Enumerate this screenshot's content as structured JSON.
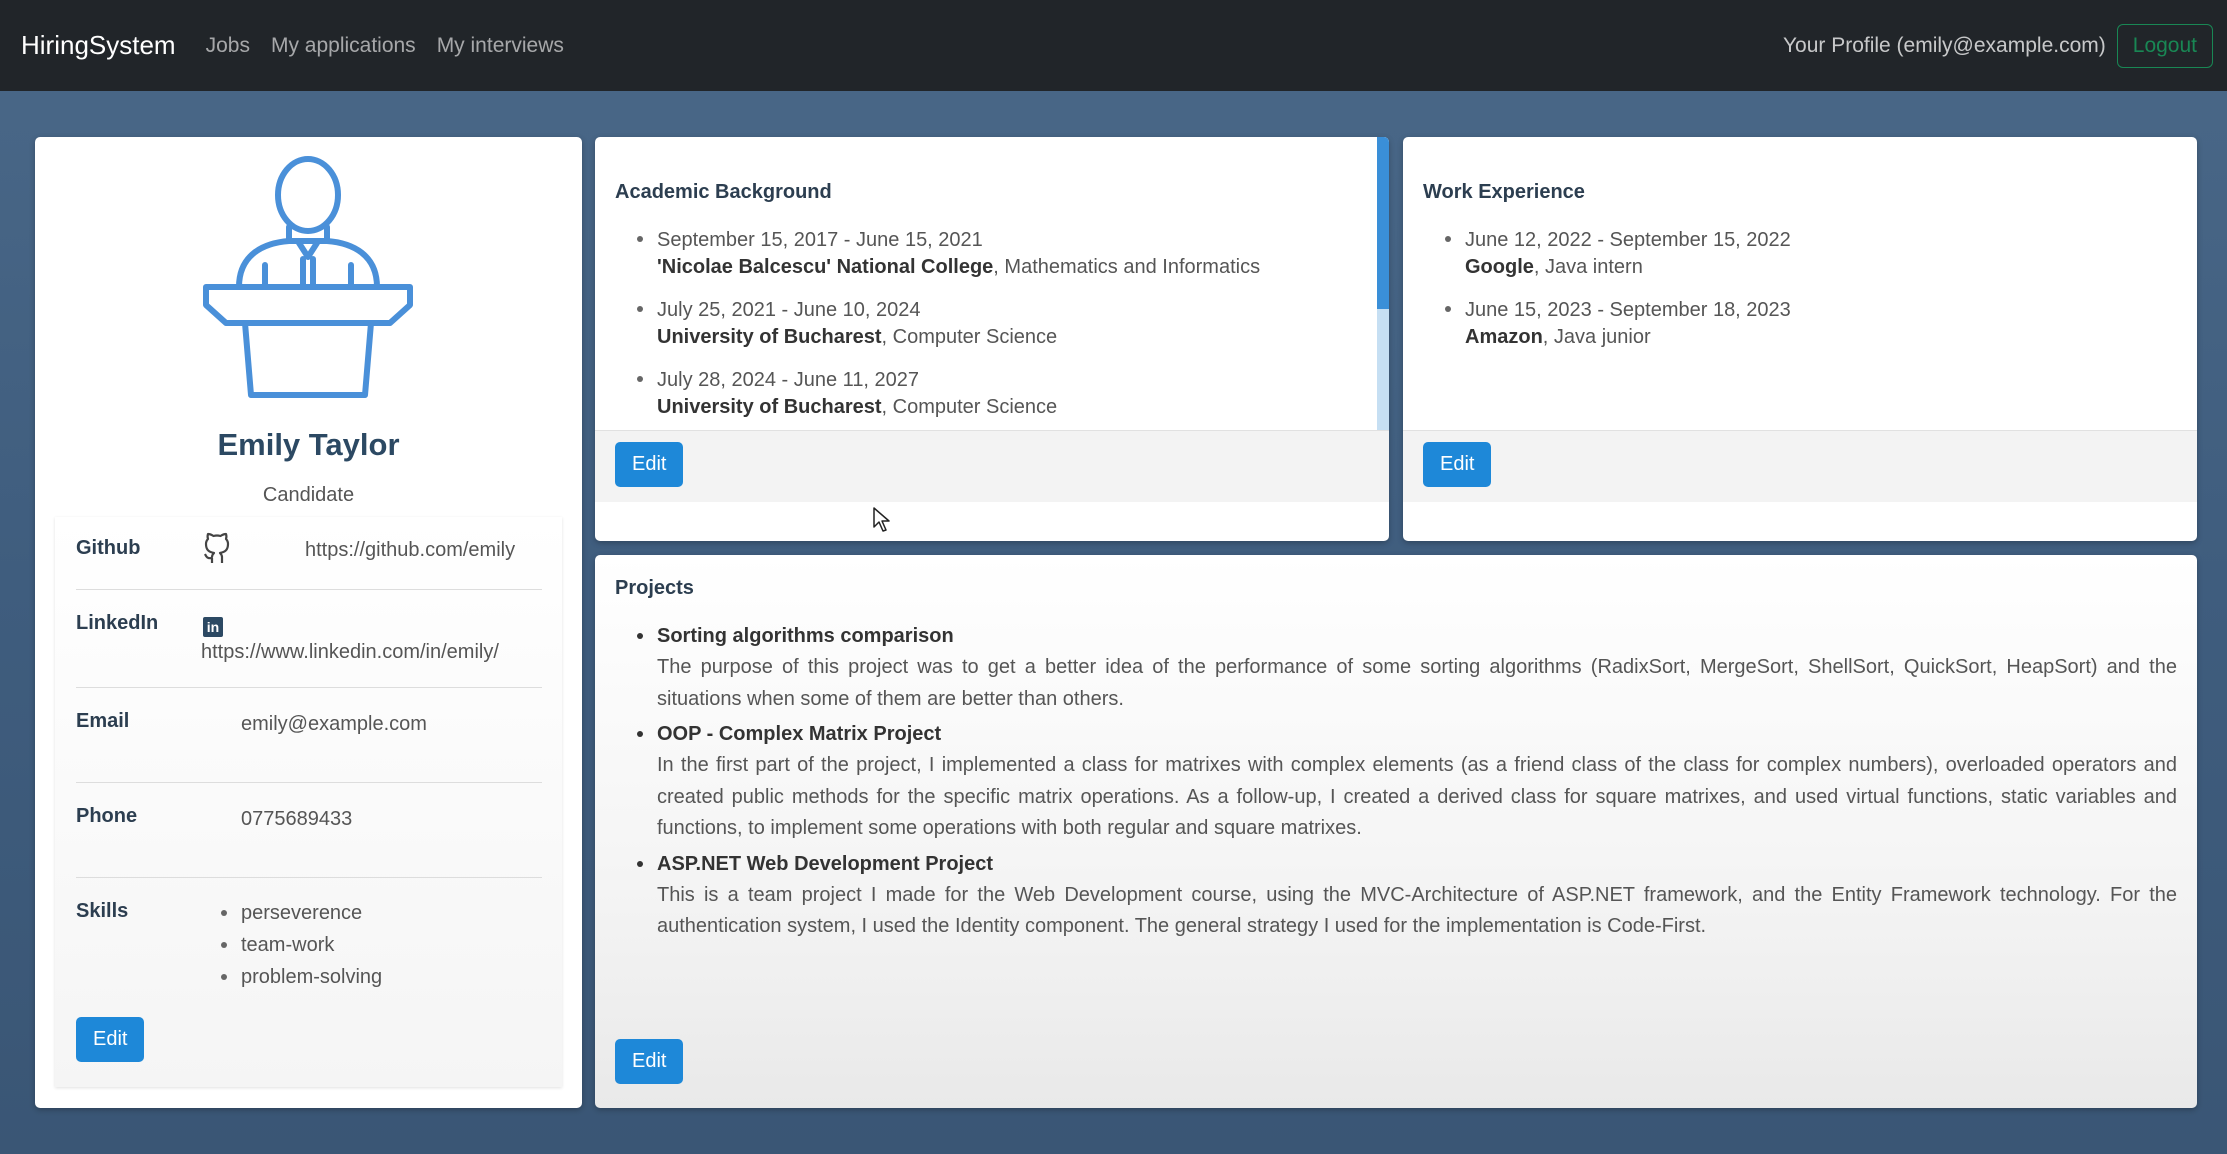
{
  "navbar": {
    "brand": "HiringSystem",
    "links": [
      "Jobs",
      "My applications",
      "My interviews"
    ],
    "profile_link": "Your Profile (emily@example.com)",
    "logout_label": "Logout"
  },
  "profile": {
    "name": "Emily Taylor",
    "role": "Candidate",
    "github_label": "Github",
    "github_url": "https://github.com/emily",
    "linkedin_label": "LinkedIn",
    "linkedin_url": "https://www.linkedin.com/in/emily/",
    "email_label": "Email",
    "email": "emily@example.com",
    "phone_label": "Phone",
    "phone": "0775689433",
    "skills_label": "Skills",
    "skills": [
      "perseverence",
      "team-work",
      "problem-solving"
    ],
    "edit_label": "Edit"
  },
  "academic": {
    "title": "Academic Background",
    "entries": [
      {
        "date": "September 15, 2017 - June 15, 2021",
        "place": "'Nicolae Balcescu' National College",
        "detail": ", Mathematics and Informatics"
      },
      {
        "date": "July 25, 2021 - June 10, 2024",
        "place": "University of Bucharest",
        "detail": ", Computer Science"
      },
      {
        "date": "July 28, 2024 - June 11, 2027",
        "place": "University of Bucharest",
        "detail": ", Computer Science"
      }
    ],
    "edit_label": "Edit"
  },
  "work": {
    "title": "Work Experience",
    "entries": [
      {
        "date": "June 12, 2022 - September 15, 2022",
        "place": "Google",
        "detail": ", Java intern"
      },
      {
        "date": "June 15, 2023 - September 18, 2023",
        "place": "Amazon",
        "detail": ", Java junior"
      }
    ],
    "edit_label": "Edit"
  },
  "projects": {
    "title": "Projects",
    "items": [
      {
        "title": "Sorting algorithms comparison",
        "description": "The purpose of this project was to get a better idea of the performance of some sorting algorithms (RadixSort, MergeSort, ShellSort, QuickSort, HeapSort) and the situations when some of them are better than others."
      },
      {
        "title": "OOP - Complex Matrix Project",
        "description": "In the first part of the project, I implemented a class for matrixes with complex elements (as a friend class of the class for complex numbers), overloaded operators and created public methods for the specific matrix operations. As a follow-up, I created a derived class for square matrixes, and used virtual functions, static variables and functions, to implement some operations with both regular and square matrixes."
      },
      {
        "title": "ASP.NET Web Development Project",
        "description": "This is a team project I made for the Web Development course, using the MVC-Architecture of ASP.NET framework, and the Entity Framework technology. For the authentication system, I used the Identity component. The general strategy I used for the implementation is Code-First."
      }
    ],
    "edit_label": "Edit"
  },
  "colors": {
    "navbar_bg": "#212529",
    "primary": "#1e88d8",
    "logout_green": "#198754",
    "avatar_blue": "#4a90d9"
  }
}
